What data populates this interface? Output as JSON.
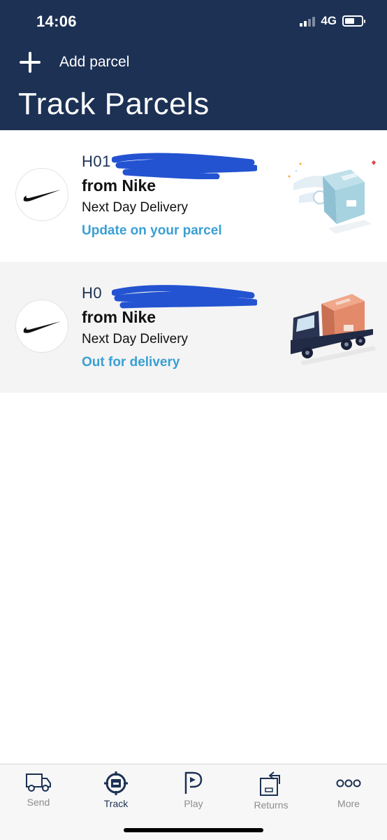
{
  "status_bar": {
    "time": "14:06",
    "network": "4G"
  },
  "header": {
    "add_label": "Add parcel",
    "title": "Track Parcels"
  },
  "parcels": [
    {
      "tracking": "H01",
      "from": "from Nike",
      "service": "Next Day Delivery",
      "status": "Update on your parcel",
      "illustration": "flying-box-icon"
    },
    {
      "tracking": "H0",
      "from": "from Nike",
      "service": "Next Day Delivery",
      "status": "Out for delivery",
      "illustration": "delivery-truck-icon"
    }
  ],
  "tabs": [
    {
      "label": "Send",
      "icon": "van-icon",
      "active": false
    },
    {
      "label": "Track",
      "icon": "track-target-icon",
      "active": true
    },
    {
      "label": "Play",
      "icon": "play-p-icon",
      "active": false
    },
    {
      "label": "Returns",
      "icon": "returns-box-icon",
      "active": false
    },
    {
      "label": "More",
      "icon": "more-dots-icon",
      "active": false
    }
  ],
  "colors": {
    "header": "#1c3154",
    "status_link": "#3a9fd4",
    "redaction": "#2353d1"
  }
}
